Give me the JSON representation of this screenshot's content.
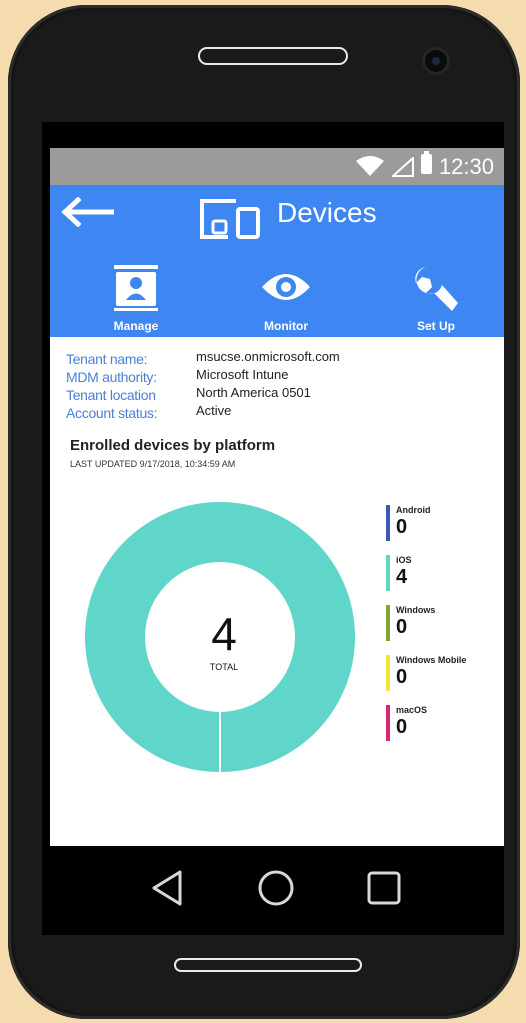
{
  "status_bar": {
    "time": "12:30"
  },
  "header": {
    "title": "Devices"
  },
  "nav": [
    {
      "label": "Manage",
      "icon": "contact-card-icon"
    },
    {
      "label": "Monitor",
      "icon": "eye-icon"
    },
    {
      "label": "Set Up",
      "icon": "wrench-icon"
    }
  ],
  "tenant": {
    "rows": [
      {
        "label": "Tenant name:",
        "value": "msucse.onmicrosoft.com"
      },
      {
        "label": "MDM authority:",
        "value": "Microsoft Intune"
      },
      {
        "label": "Tenant location",
        "value": "North America 0501"
      },
      {
        "label": "Account status:",
        "value": "Active"
      }
    ]
  },
  "enrolled": {
    "title": "Enrolled devices by platform",
    "last_updated": "LAST UPDATED 9/17/2018, 10:34:59 AM",
    "total": "4",
    "total_label": "TOTAL"
  },
  "chart_data": {
    "type": "pie",
    "categories": [
      "Android",
      "iOS",
      "Windows",
      "Windows Mobile",
      "macOS"
    ],
    "values": [
      0,
      4,
      0,
      0,
      0
    ],
    "colors": [
      "#3a5bb5",
      "#5fd6c9",
      "#7aa832",
      "#f5e23a",
      "#d6257a"
    ]
  },
  "legend": [
    {
      "name": "Android",
      "count": "0",
      "color": "#3a5bb5"
    },
    {
      "name": "iOS",
      "count": "4",
      "color": "#5fd6c9"
    },
    {
      "name": "Windows",
      "count": "0",
      "color": "#7aa832"
    },
    {
      "name": "Windows Mobile",
      "count": "0",
      "color": "#f5e23a"
    },
    {
      "name": "macOS",
      "count": "0",
      "color": "#d6257a"
    }
  ]
}
